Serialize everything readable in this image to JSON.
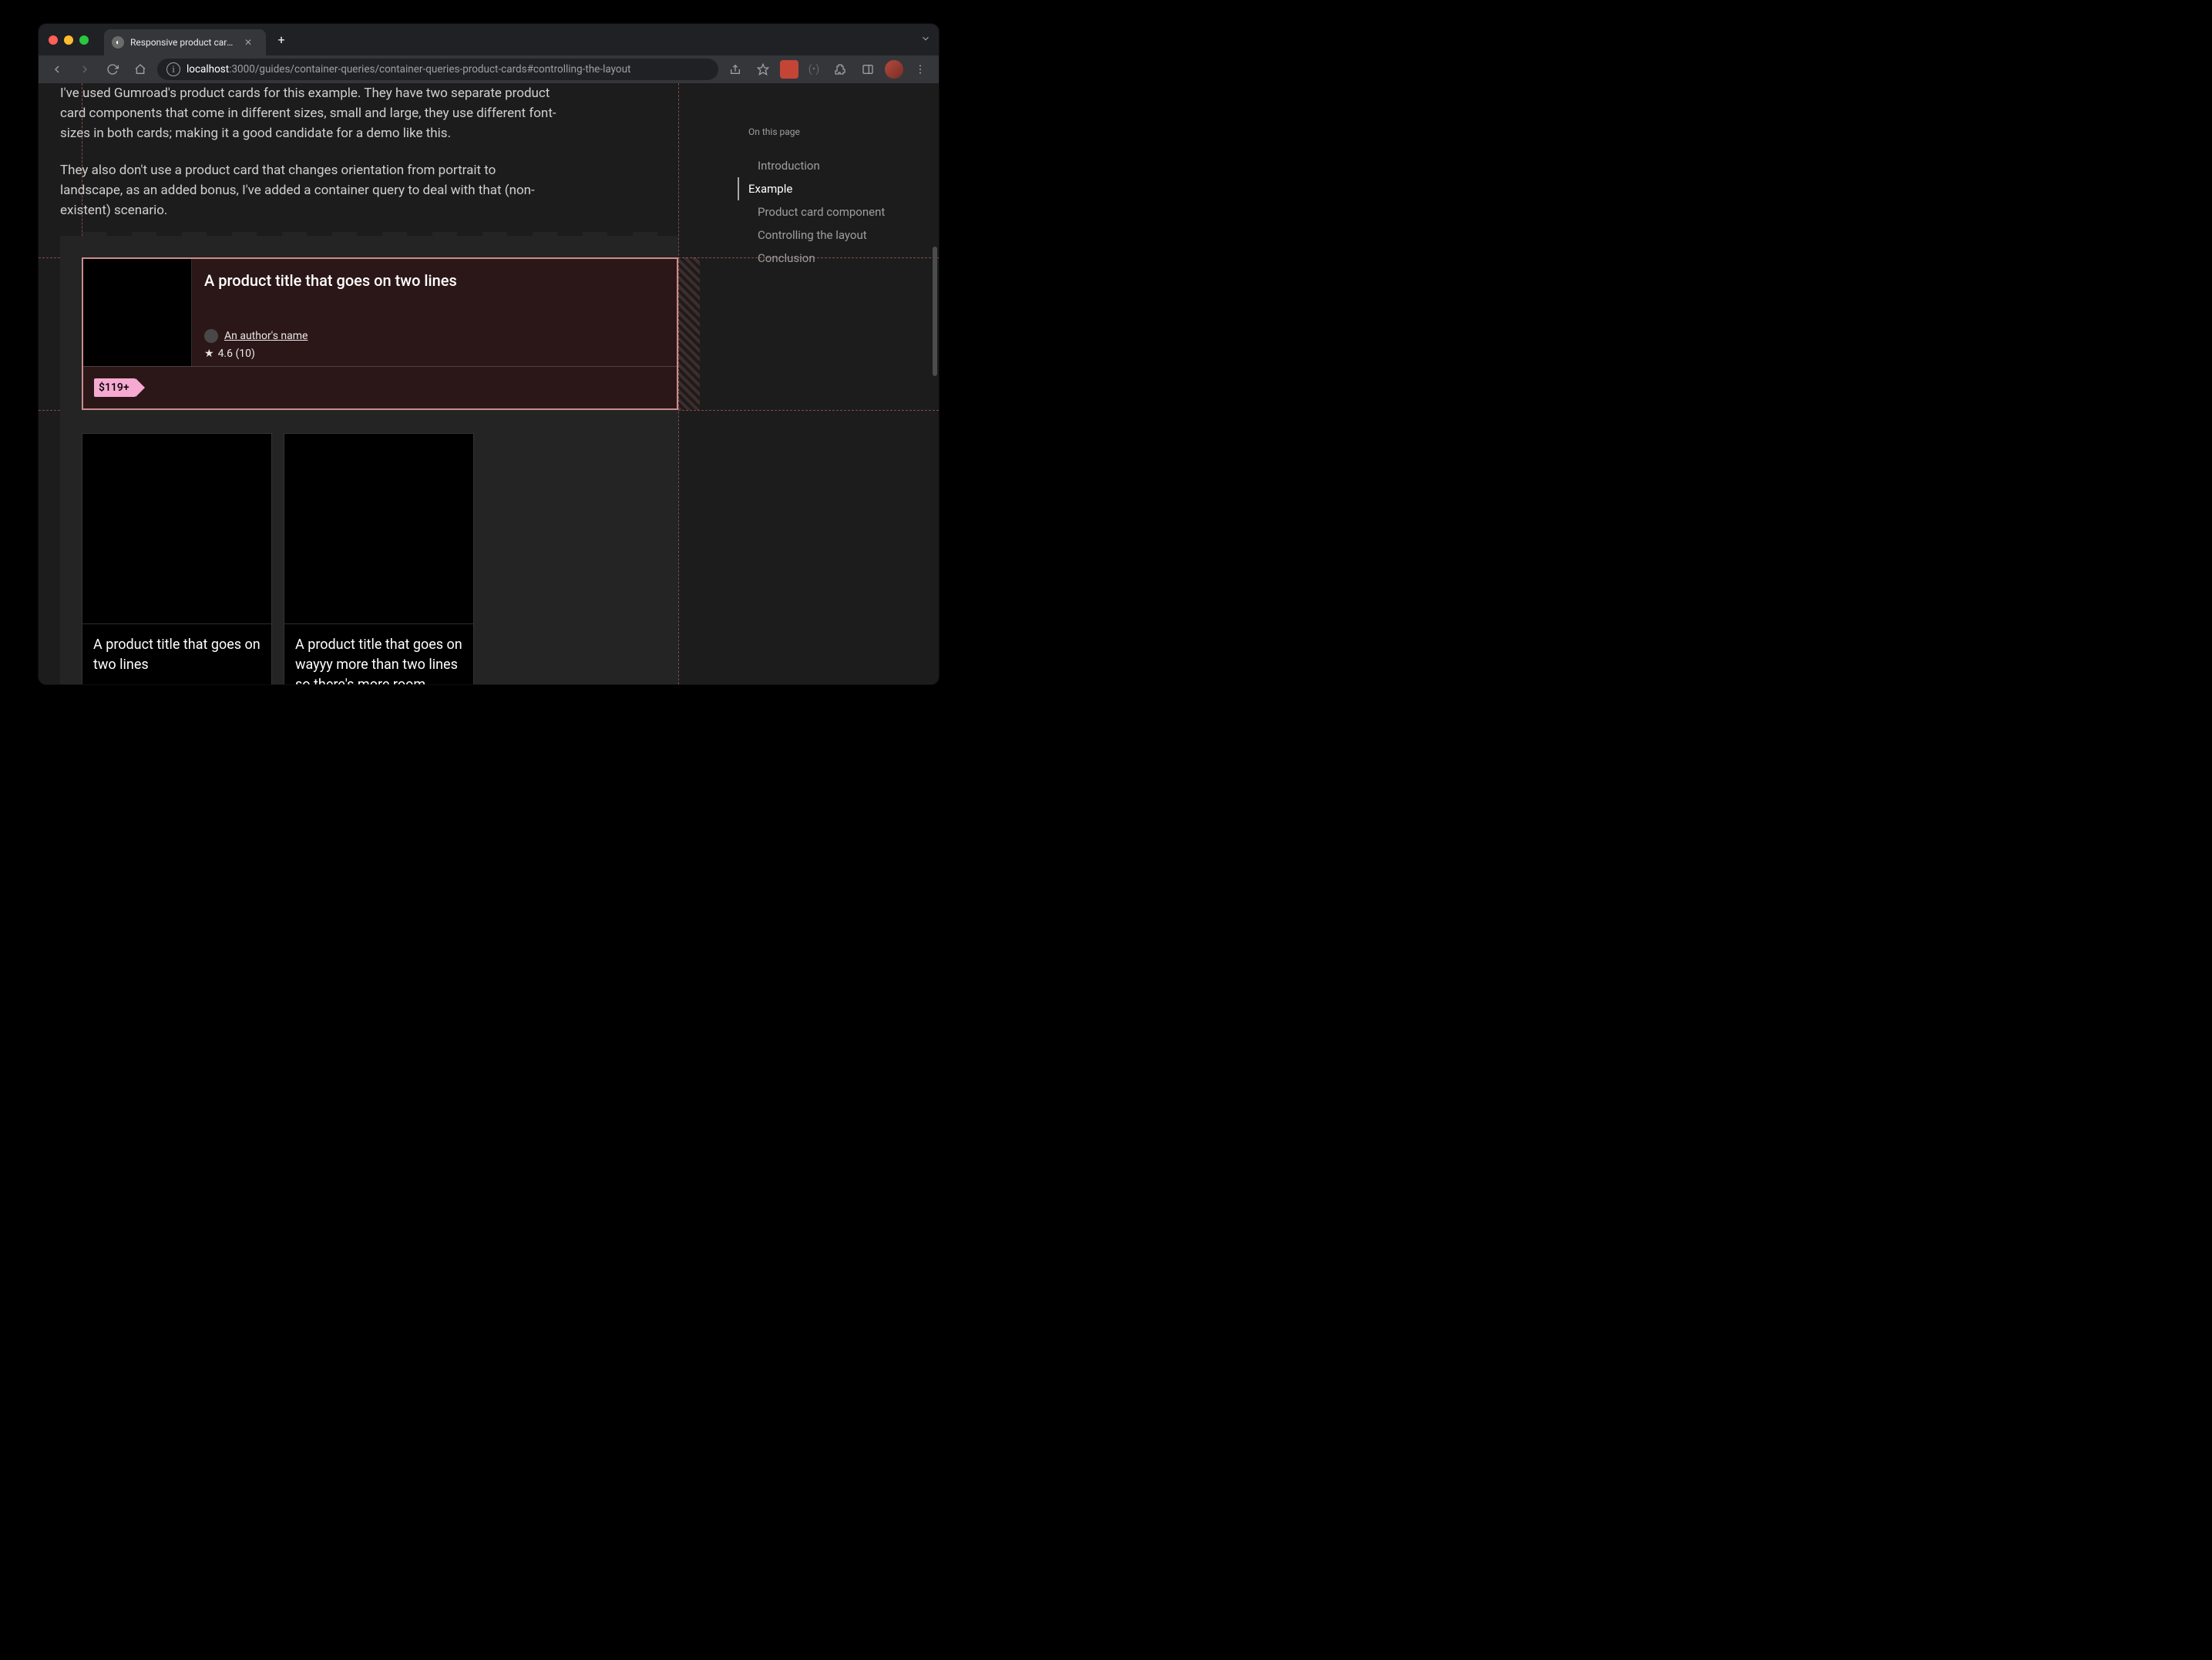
{
  "browser": {
    "tab_title": "Responsive product cards built",
    "url_host": "localhost",
    "url_port_path": ":3000/guides/container-queries/container-queries-product-cards#controlling-the-layout"
  },
  "article": {
    "p1": "I've used Gumroad's product cards for this example. They have two separate product card components that come in different sizes, small and large, they use different font-sizes in both cards; making it a good candidate for a demo like this.",
    "p2": "They also don't use a product card that changes orientation from portrait to landscape, as an added bonus, I've added a container query to deal with that (non-existent) scenario."
  },
  "toc": {
    "heading": "On this page",
    "items": [
      {
        "label": "Introduction",
        "active": false
      },
      {
        "label": "Example",
        "active": true
      },
      {
        "label": "Product card component",
        "active": false
      },
      {
        "label": "Controlling the layout",
        "active": false
      },
      {
        "label": "Conclusion",
        "active": false
      }
    ]
  },
  "big_card": {
    "title": "A product title that goes on two lines",
    "author": "An author's name",
    "rating": "4.6 (10)",
    "price": "$119+"
  },
  "small_cards": [
    {
      "title": "A product title that goes on two lines"
    },
    {
      "title": "A product title that goes on wayyy more than two lines so there's more room"
    }
  ]
}
